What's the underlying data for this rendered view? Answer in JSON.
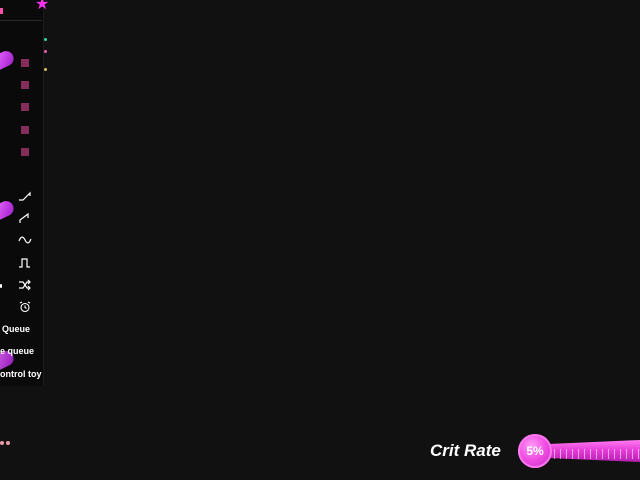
{
  "queue_menu": {
    "queue_label": "Queue",
    "clear_queue_label": "e queue",
    "control_toy_label": "ontrol toy"
  },
  "icons": {
    "favorite": "star-icon",
    "menu": "menu-icon",
    "pattern_ramp_up": "ramp-up-icon",
    "pattern_ramp_steep": "ramp-steep-icon",
    "pattern_wave": "wave-icon",
    "pattern_pulse": "pulse-icon",
    "pattern_random": "shuffle-icon",
    "pattern_alarm": "alarm-icon",
    "toy": "toy-icon"
  },
  "stats": {
    "crit_rate_label": "Crit Rate",
    "crit_rate_value": "5%",
    "crit_rate_fraction": 0.05
  },
  "colors": {
    "background": "#111112",
    "panel": "#0a0a0b",
    "accent": "#ff33ee",
    "menu_icon": "#ff4fa8",
    "text": "#ffffff"
  }
}
